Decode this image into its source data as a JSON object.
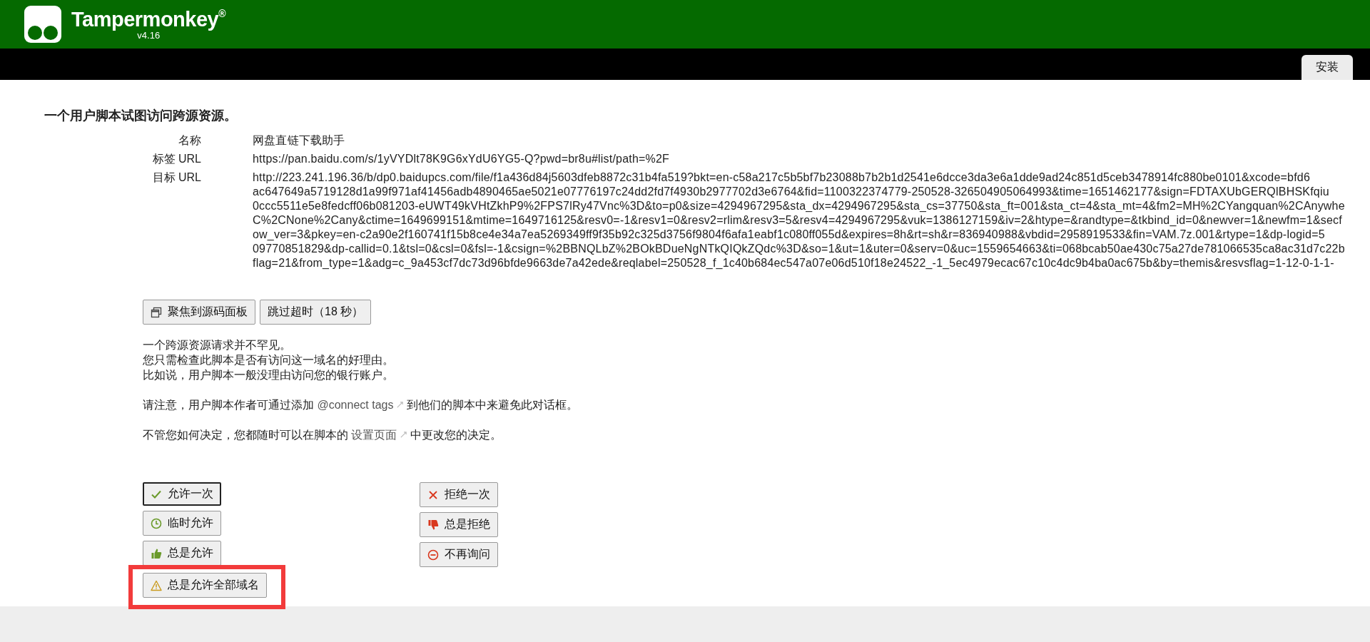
{
  "header": {
    "title": "Tampermonkey",
    "registered_mark": "®",
    "version": "v4.16"
  },
  "tabs": [
    {
      "label": "安装",
      "selected": true
    }
  ],
  "heading": "一个用户脚本试图访问跨源资源。",
  "details": [
    {
      "label": "名称",
      "lines": [
        "网盘直链下载助手"
      ]
    },
    {
      "label": "标签 URL",
      "lines": [
        "https://pan.baidu.com/s/1yVYDlt78K9G6xYdU6YG5-Q?pwd=br8u#list/path=%2F"
      ]
    },
    {
      "label": "目标 URL",
      "lines": [
        "http://223.241.196.36/b/dp0.baidupcs.com/file/f1a436d84j5603dfeb8872c31b4fa519?bkt=en-c58a217c5b5bf7b23088b7b2b1d2541e6dcce3da3e6a1dde9ad24c851d5ceb3478914fc880be0101&xcode=bfd6",
        "ac647649a5719128d1a99f971af41456adb4890465ae5021e07776197c24dd2fd7f4930b2977702d3e6764&fid=1100322374779-250528-326504905064993&time=1651462177&sign=FDTAXUbGERQlBHSKfqiu",
        "0ccc5511e5e8fedcff06b081203-eUWT49kVHtZkhP9%2FPS7lRy47Vnc%3D&to=p0&size=4294967295&sta_dx=4294967295&sta_cs=37750&sta_ft=001&sta_ct=4&sta_mt=4&fm2=MH%2CYangquan%2CAnywhe",
        "C%2CNone%2Cany&ctime=1649699151&mtime=1649716125&resv0=-1&resv1=0&resv2=rlim&resv3=5&resv4=4294967295&vuk=1386127159&iv=2&htype=&randtype=&tkbind_id=0&newver=1&newfm=1&secf",
        "ow_ver=3&pkey=en-c2a90e2f160741f15b8ce4e34a7ea5269349ff9f35b92c325d3756f9804f6afa1eabf1c080ff055d&expires=8h&rt=sh&r=836940988&vbdid=2958919533&fin=VAM.7z.001&rtype=1&dp-logid=5",
        "09770851829&dp-callid=0.1&tsl=0&csl=0&fsl=-1&csign=%2BBNQLbZ%2BOkBDueNgNTkQIQkZQdc%3D&so=1&ut=1&uter=0&serv=0&uc=1559654663&ti=068bcab50ae430c75a27de781066535ca8ac31d7c22b",
        "flag=21&from_type=1&adg=c_9a453cf7dc73d96bfde9663de7a42ede&reqlabel=250528_f_1c40b684ec547a07e06d510f18e24522_-1_5ec4979ecac67c10c4dc9b4ba0ac675b&by=themis&resvsflag=1-12-0-1-1-"
      ]
    }
  ],
  "source_buttons": [
    {
      "label": "聚焦到源码面板",
      "kind": "window"
    },
    {
      "label": "跳过超时（18 秒）",
      "kind": "plain"
    }
  ],
  "info_lines": [
    "一个跨源资源请求并不罕见。",
    "您只需检查此脚本是否有访问这一域名的好理由。",
    "比如说，用户脚本一般没理由访问您的银行账户。"
  ],
  "notes": [
    {
      "before": "请注意，用户脚本作者可通过添加",
      "link": "@connect tags",
      "after": "到他们的脚本中来避免此对话框。"
    },
    {
      "before": "不管您如何决定，您都随时可以在脚本的",
      "link": "设置页面",
      "after": "中更改您的决定。"
    }
  ],
  "actions": {
    "allow": [
      {
        "label": "允许一次",
        "kind": "check",
        "focused": true,
        "highlighted": false
      },
      {
        "label": "临时允许",
        "kind": "clock",
        "focused": false,
        "highlighted": false
      },
      {
        "label": "总是允许",
        "kind": "thumbs-up",
        "focused": false,
        "highlighted": false
      },
      {
        "label": "总是允许全部域名",
        "kind": "warning",
        "focused": false,
        "highlighted": true
      }
    ],
    "deny": [
      {
        "label": "拒绝一次",
        "kind": "cross",
        "focused": false,
        "highlighted": false
      },
      {
        "label": "总是拒绝",
        "kind": "thumbs-down",
        "focused": false,
        "highlighted": false
      },
      {
        "label": "不再询问",
        "kind": "minus-circle",
        "focused": false,
        "highlighted": false
      }
    ]
  }
}
